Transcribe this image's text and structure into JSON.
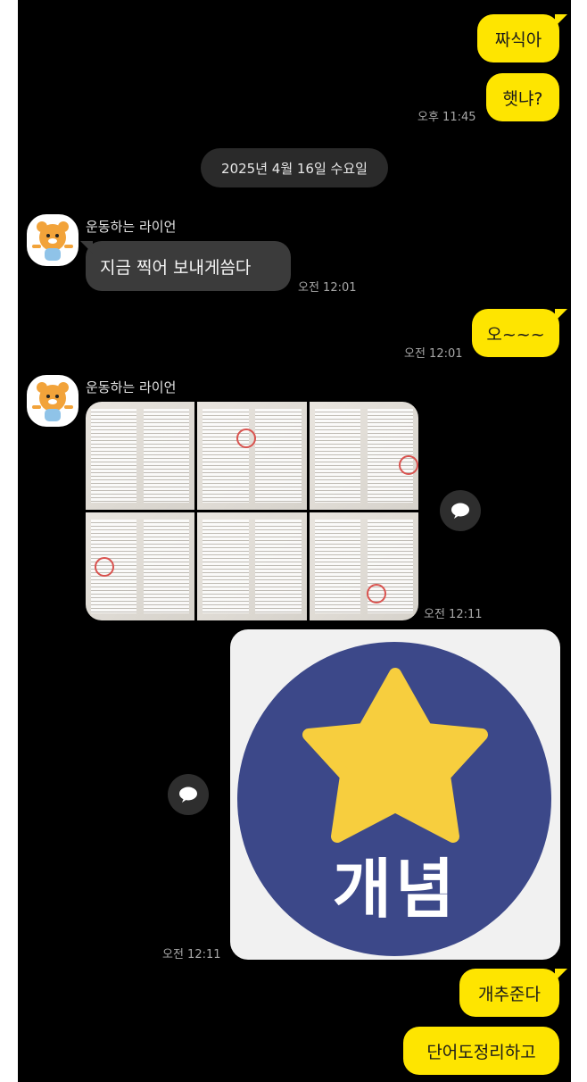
{
  "messages_top": {
    "m1": "짜식아",
    "m2": "햇냐?",
    "t1": "오후 11:45"
  },
  "date_divider": "2025년 4월 16일 수요일",
  "group1": {
    "sender": "운동하는 라이언",
    "text": "지금 찍어 보내게씀다",
    "time": "오전 12:01"
  },
  "reply1": {
    "text": "오~~~",
    "time": "오전 12:01"
  },
  "group2": {
    "sender": "운동하는 라이언",
    "photo_count": 6,
    "time": "오전 12:11"
  },
  "image_message": {
    "text": "개념",
    "time": "오전 12:11",
    "circle_color": "#3c4889",
    "star_color": "#f7ce3e"
  },
  "bottom": {
    "m1": "개추준다",
    "m2": "단어도정리하고"
  },
  "colors": {
    "my_bubble": "#fee500",
    "other_bubble": "#3b3b3b",
    "background": "#000000"
  },
  "icons": {
    "share": "share-chat-icon",
    "avatar": "ryan-avatar-icon"
  }
}
